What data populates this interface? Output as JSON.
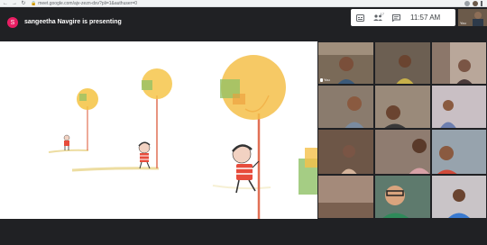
{
  "browser": {
    "url": "meet.google.com/ajv-zezn-dxv?pli=1&authuser=0",
    "back_icon": "arrow-left",
    "forward_icon": "arrow-right",
    "reload_icon": "reload",
    "lock_icon": "lock"
  },
  "meeting": {
    "presenter_initial": "S",
    "presenter_text": "sangeetha Navgire is presenting",
    "presenter_color": "#e91e63",
    "time": "11:57 AM",
    "participants_count": "17",
    "self_label": "You"
  },
  "controls": {
    "icons": [
      "captions-icon",
      "people-icon",
      "chat-icon"
    ]
  },
  "tiles": [
    {
      "name": "You",
      "bg": "#7a6a58"
    },
    {
      "name": "",
      "bg": "#6c5f52"
    },
    {
      "name": "",
      "bg": "#b9a79a"
    },
    {
      "name": "",
      "bg": "#8a7b6d"
    },
    {
      "name": "",
      "bg": "#9a8a7a"
    },
    {
      "name": "",
      "bg": "#c9bfc4"
    },
    {
      "name": "",
      "bg": "#6d5647"
    },
    {
      "name": "",
      "bg": "#8f7c70"
    },
    {
      "name": "",
      "bg": "#97a3ad"
    },
    {
      "name": "",
      "bg": "#a48a7a"
    },
    {
      "name": "",
      "bg": "#5e7a6d"
    },
    {
      "name": "",
      "bg": "#c9c4c7"
    }
  ]
}
